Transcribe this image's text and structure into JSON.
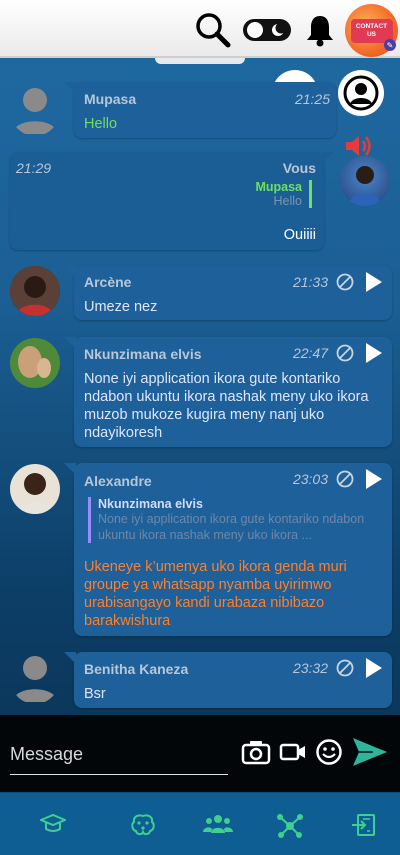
{
  "header": {
    "search_icon": "search-icon",
    "theme_toggle_icon": "theme-toggle-icon",
    "notifications_icon": "bell-icon",
    "contact_label": "CONTACT US"
  },
  "fabs": {
    "groups": "groups-icon",
    "profile": "person-icon"
  },
  "messages": [
    {
      "sender": "Mupasa",
      "time": "21:25",
      "text": "Hello",
      "text_color": "#6fe05a"
    },
    {
      "sender": "Vous",
      "time": "21:29",
      "reply_to_name": "Mupasa",
      "reply_to_text": "Hello",
      "text": "Ouiiii"
    },
    {
      "sender": "Arcène",
      "time": "21:33",
      "text": "Umeze nez"
    },
    {
      "sender": "Nkunzimana elvis",
      "time": "22:47",
      "text": "None iyi application ikora gute kontariko ndabon ukuntu ikora nashak meny uko ikora muzob mukoze kugira meny nanj uko ndayikoresh"
    },
    {
      "sender": "Alexandre",
      "time": "23:03",
      "reply_to_name": "Nkunzimana elvis",
      "reply_to_text": "None iyi application ikora gute kontariko ndabon ukuntu ikora nashak meny uko ikora ...",
      "text": "Ukeneye k’umenya uko ikora genda muri groupe ya whatsapp nyamba uyirimwo urabisangayo kandi urabaza nibibazo barakwishura",
      "text_color": "#ff7f2a"
    },
    {
      "sender": "Benitha Kaneza",
      "time": "23:32",
      "text": "Bsr"
    }
  ],
  "composer": {
    "placeholder": "Message"
  },
  "bottom_nav": [
    "graduation-cap-icon",
    "brain-icon",
    "group-icon",
    "network-icon",
    "exit-icon"
  ],
  "colors": {
    "accent_green": "#3fcf8e",
    "bubble": "#1d609a",
    "nav_bg": "#0e5e94"
  }
}
